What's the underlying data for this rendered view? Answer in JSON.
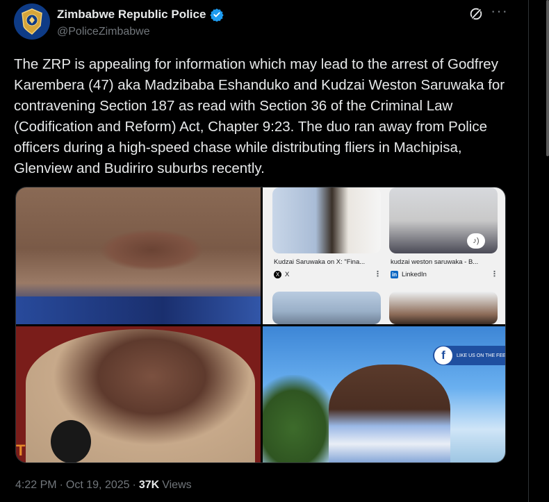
{
  "author": {
    "display_name": "Zimbabwe Republic Police",
    "handle": "@PoliceZimbabwe",
    "verified": true
  },
  "tweet": {
    "text": "The ZRP is appealing for information which may lead to the arrest of Godfrey Karembera (47) aka Madzibaba Eshanduko and Kudzai Weston Saruwaka for contravening Section 187 as read with Section 36 of the Criminal Law (Codification and Reform) Act, Chapter 9:23. The duo ran away from Police officers during a high-speed chase while distributing fliers in Machipisa, Glenview and Budiriro suburbs recently."
  },
  "media": {
    "search_results": [
      {
        "title": "Kudzai Saruwaka on X: \"Fina...",
        "source": "X",
        "source_icon": "x-logo-icon"
      },
      {
        "title": "kudzai weston saruwaka - B...",
        "source": "LinkedIn",
        "source_icon": "linkedin-logo-icon"
      }
    ],
    "facebook_banner": "LIKE US ON THE FEE"
  },
  "meta": {
    "time": "4:22 PM",
    "separator": "·",
    "date": "Oct 19, 2025",
    "views_count": "37K",
    "views_label": "Views"
  },
  "colors": {
    "background": "#000000",
    "text": "#e7e9ea",
    "secondary_text": "#71767b",
    "verified": "#1d9bf0"
  }
}
